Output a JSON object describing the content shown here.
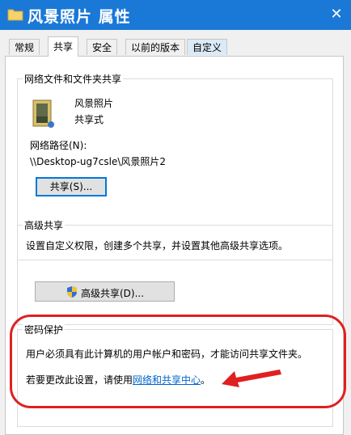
{
  "window": {
    "title": "风景照片 属性",
    "close_glyph": "✕"
  },
  "tabs": [
    {
      "label": "常规",
      "active": false
    },
    {
      "label": "共享",
      "active": true
    },
    {
      "label": "安全",
      "active": false
    },
    {
      "label": "以前的版本",
      "active": false
    },
    {
      "label": "自定义",
      "active": false
    }
  ],
  "network_sharing": {
    "legend": "网络文件和文件夹共享",
    "folder_name": "风景照片",
    "share_state": "共享式",
    "path_label": "网络路径(N):",
    "path_value": "\\\\Desktop-ug7csle\\风景照片2",
    "share_button": "共享(S)..."
  },
  "advanced_sharing": {
    "legend": "高级共享",
    "description": "设置自定义权限，创建多个共享，并设置其他高级共享选项。",
    "button": "高级共享(D)..."
  },
  "password_protection": {
    "legend": "密码保护",
    "description": "用户必须具有此计算机的用户帐户和密码，才能访问共享文件夹。",
    "change_prefix": "若要更改此设置，请使用",
    "change_link": "网络和共享中心",
    "change_suffix": "。"
  },
  "colors": {
    "titlebar": "#1a78d6",
    "highlight_oval": "#e02020",
    "link": "#0066cc",
    "focus": "#0078d7"
  }
}
